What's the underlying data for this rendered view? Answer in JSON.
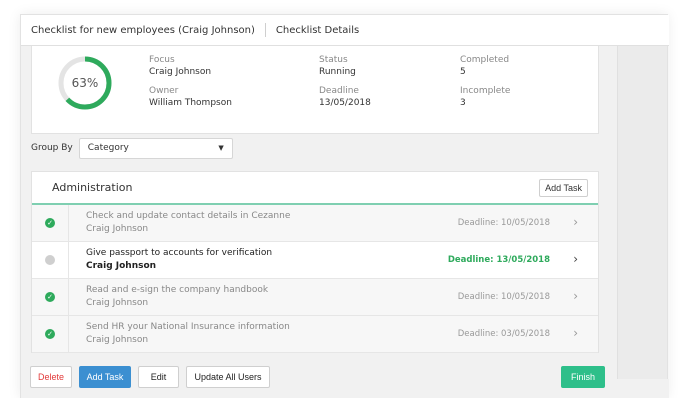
{
  "header": {
    "title": "Checklist for new employees (Craig Johnson)",
    "details_tab": "Checklist Details"
  },
  "summary": {
    "progress_percent": 63,
    "progress_label": "63%",
    "focus": {
      "label": "Focus",
      "value": "Craig Johnson"
    },
    "owner": {
      "label": "Owner",
      "value": "William Thompson"
    },
    "status": {
      "label": "Status",
      "value": "Running"
    },
    "deadline": {
      "label": "Deadline",
      "value": "13/05/2018"
    },
    "completed": {
      "label": "Completed",
      "value": "5"
    },
    "incomplete": {
      "label": "Incomplete",
      "value": "3"
    }
  },
  "group_by": {
    "label": "Group By",
    "selected": "Category"
  },
  "category": {
    "title": "Administration",
    "add_task_label": "Add Task",
    "tasks": [
      {
        "title": "Check and update contact details in Cezanne",
        "owner": "Craig Johnson",
        "deadline": "Deadline: 10/05/2018",
        "done": true
      },
      {
        "title": "Give passport to accounts for verification",
        "owner": "Craig Johnson",
        "deadline": "Deadline: 13/05/2018",
        "done": false
      },
      {
        "title": "Read and e-sign the company handbook",
        "owner": "Craig Johnson",
        "deadline": "Deadline: 10/05/2018",
        "done": true
      },
      {
        "title": "Send HR your National Insurance information",
        "owner": "Craig Johnson",
        "deadline": "Deadline: 03/05/2018",
        "done": true
      }
    ]
  },
  "footer": {
    "delete_label": "Delete",
    "add_task_label": "Add Task",
    "edit_label": "Edit",
    "update_all_label": "Update All Users",
    "finish_label": "Finish"
  },
  "colors": {
    "accent_green": "#2eaa5c",
    "donut_track": "#e4e4e4",
    "delete_red": "#e23b3b",
    "add_blue": "#3b8fd1",
    "finish_green": "#2ebf8a"
  }
}
